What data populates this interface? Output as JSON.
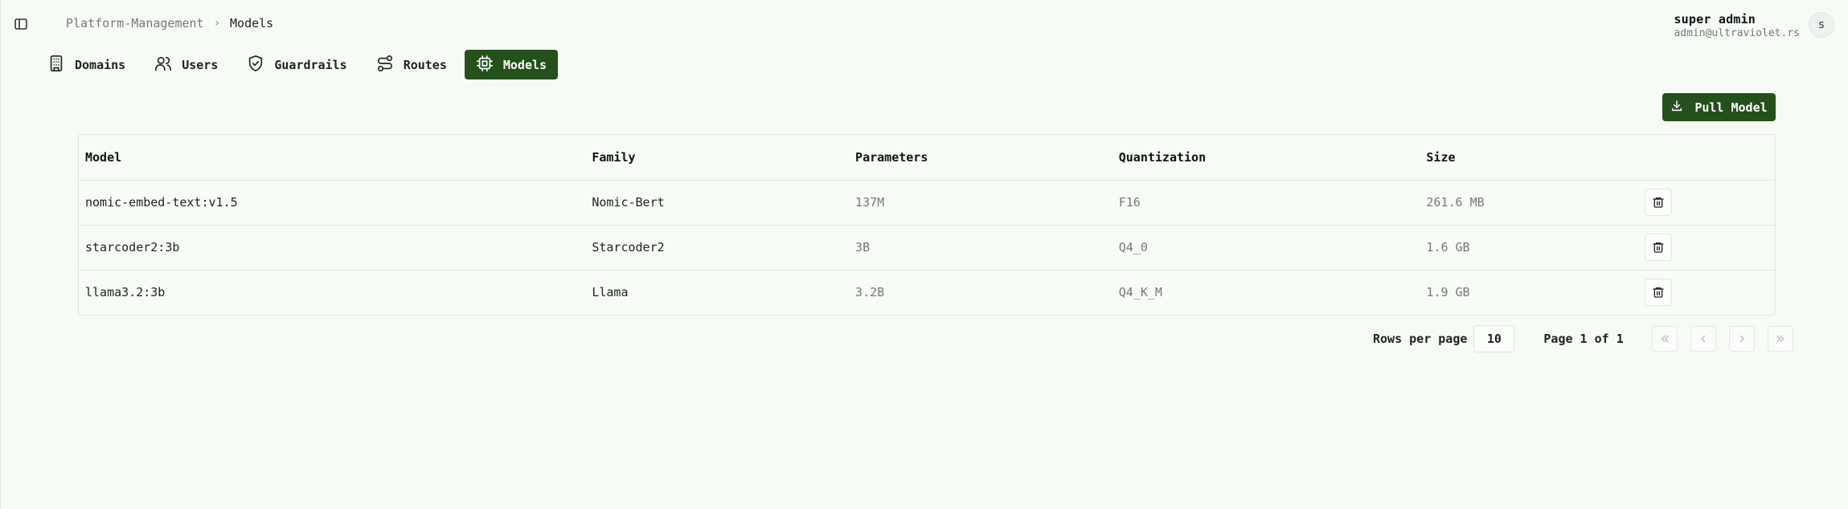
{
  "breadcrumb": {
    "parent": "Platform-Management",
    "separator": "›",
    "current": "Models"
  },
  "user": {
    "name": "super admin",
    "email": "admin@ultraviolet.rs",
    "avatar_letter": "s"
  },
  "nav": [
    {
      "label": "Domains",
      "icon": "building-icon",
      "active": false
    },
    {
      "label": "Users",
      "icon": "users-icon",
      "active": false
    },
    {
      "label": "Guardrails",
      "icon": "shield-check-icon",
      "active": false
    },
    {
      "label": "Routes",
      "icon": "route-icon",
      "active": false
    },
    {
      "label": "Models",
      "icon": "cpu-icon",
      "active": true
    }
  ],
  "actions": {
    "pull_model": "Pull Model"
  },
  "table": {
    "headers": [
      "Model",
      "Family",
      "Parameters",
      "Quantization",
      "Size"
    ],
    "rows": [
      {
        "model": "nomic-embed-text:v1.5",
        "family": "Nomic-Bert",
        "parameters": "137M",
        "quantization": "F16",
        "size": "261.6 MB"
      },
      {
        "model": "starcoder2:3b",
        "family": "Starcoder2",
        "parameters": "3B",
        "quantization": "Q4_0",
        "size": "1.6 GB"
      },
      {
        "model": "llama3.2:3b",
        "family": "Llama",
        "parameters": "3.2B",
        "quantization": "Q4_K_M",
        "size": "1.9 GB"
      }
    ]
  },
  "pagination": {
    "rows_per_page_label": "Rows per page",
    "rows_per_page": "10",
    "page_label": "Page 1 of 1"
  },
  "colors": {
    "accent": "#24501b",
    "background": "#f6fbf6"
  }
}
